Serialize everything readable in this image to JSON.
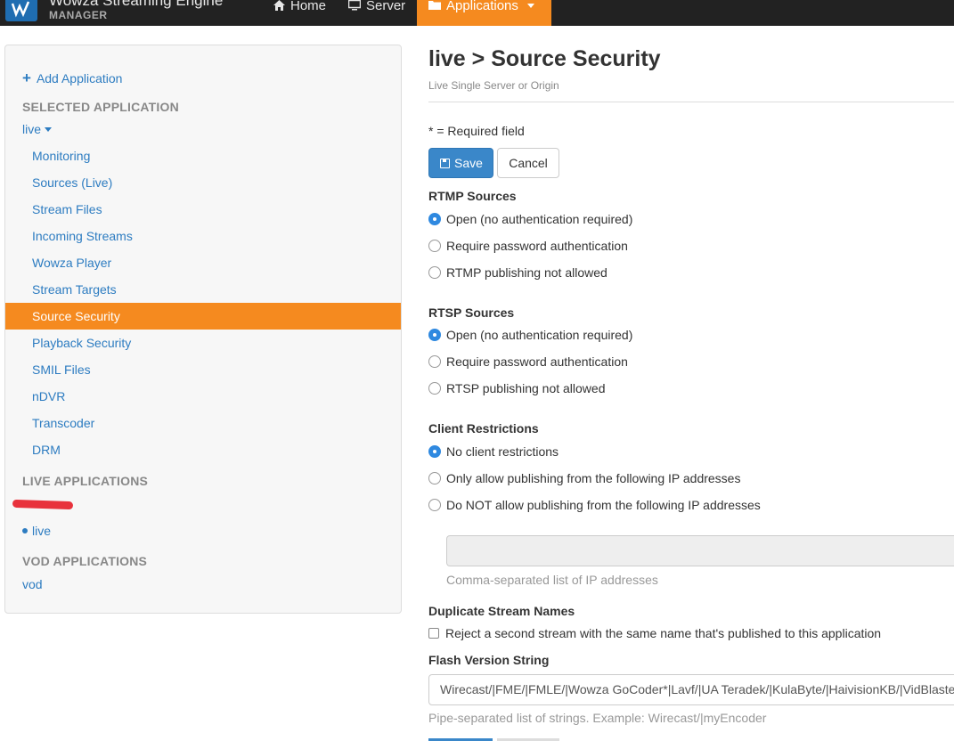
{
  "brand": {
    "title": "Wowza Streaming Engine",
    "subtitle": "MANAGER"
  },
  "nav": {
    "home": "Home",
    "server": "Server",
    "applications": "Applications"
  },
  "sidebar": {
    "add_application": "Add Application",
    "selected_heading": "SELECTED APPLICATION",
    "selected_app": "live",
    "items": [
      {
        "label": "Monitoring"
      },
      {
        "label": "Sources (Live)"
      },
      {
        "label": "Stream Files"
      },
      {
        "label": "Incoming Streams"
      },
      {
        "label": "Wowza Player"
      },
      {
        "label": "Stream Targets"
      },
      {
        "label": "Source Security",
        "active": true
      },
      {
        "label": "Playback Security"
      },
      {
        "label": "SMIL Files"
      },
      {
        "label": "nDVR"
      },
      {
        "label": "Transcoder"
      },
      {
        "label": "DRM"
      }
    ],
    "live_heading": "LIVE APPLICATIONS",
    "live_app": "live",
    "vod_heading": "VOD APPLICATIONS",
    "vod_app": "vod"
  },
  "main": {
    "title": "live > Source Security",
    "subtitle": "Live Single Server or Origin",
    "required_note": "* = Required field",
    "save_label": "Save",
    "cancel_label": "Cancel",
    "rtmp": {
      "heading": "RTMP Sources",
      "options": [
        "Open (no authentication required)",
        "Require password authentication",
        "RTMP publishing not allowed"
      ],
      "selected": 0
    },
    "rtsp": {
      "heading": "RTSP Sources",
      "options": [
        "Open (no authentication required)",
        "Require password authentication",
        "RTSP publishing not allowed"
      ],
      "selected": 0
    },
    "client": {
      "heading": "Client Restrictions",
      "options": [
        "No client restrictions",
        "Only allow publishing from the following IP addresses",
        "Do NOT allow publishing from the following IP addresses"
      ],
      "selected": 0,
      "ip_value": "",
      "ip_help": "Comma-separated list of IP addresses"
    },
    "duplicate": {
      "heading": "Duplicate Stream Names",
      "checkbox_label": "Reject a second stream with the same name that's published to this application",
      "checked": false
    },
    "flash": {
      "heading": "Flash Version String",
      "value": "Wirecast/|FME/|FMLE/|Wowza GoCoder*|Lavf/|UA Teradek/|KulaByte/|HaivisionKB/|VidBlaster/",
      "help": "Pipe-separated list of strings. Example: Wirecast/|myEncoder"
    }
  },
  "colors": {
    "accent": "#f58a1f",
    "primary": "#3a87c9",
    "link": "#2d7cc1",
    "navbar": "#222222"
  }
}
